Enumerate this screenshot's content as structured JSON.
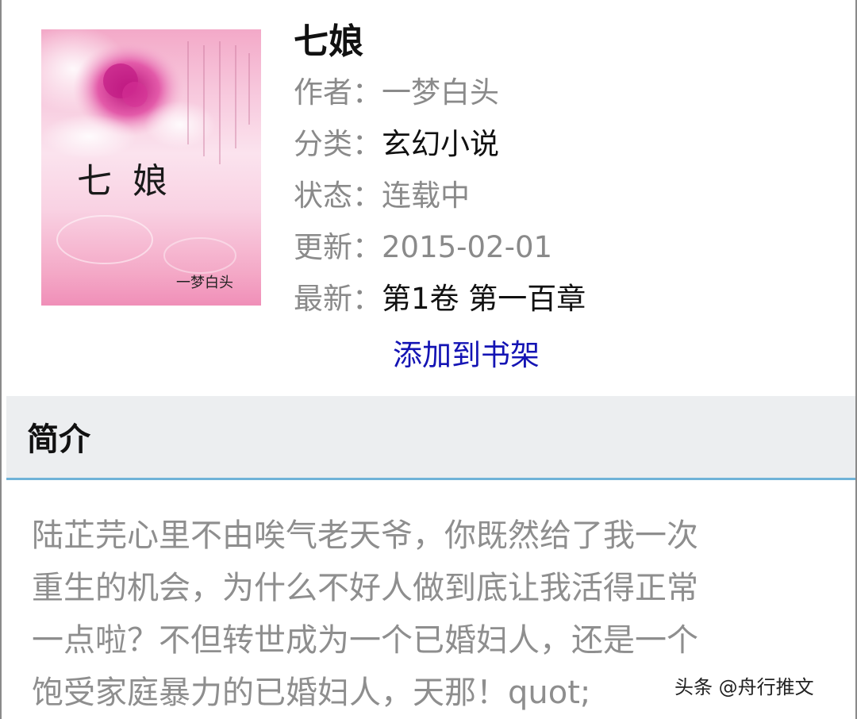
{
  "book": {
    "title": "七娘",
    "cover": {
      "title": "七 娘",
      "author": "一梦白头"
    },
    "author_label": "作者：",
    "author": "一梦白头",
    "category_label": "分类：",
    "category": "玄幻小说",
    "status_label": "状态：",
    "status": "连载中",
    "updated_label": "更新：",
    "updated": "2015-02-01",
    "latest_label": "最新：",
    "latest": "第1卷 第一百章",
    "add_to_shelf": "添加到书架"
  },
  "intro": {
    "heading": "简介",
    "lines": [
      "陆芷芫心里不由唉气老天爷，你既然给了我一次",
      "重生的机会，为什么不好人做到底让我活得正常",
      "一点啦？不但转世成为一个已婚妇人，还是一个",
      "饱受家庭暴力的已婚妇人，天那！quot;"
    ]
  },
  "watermark": "头条 @舟行推文",
  "colors": {
    "link": "#1414b4",
    "muted_text": "#8a8a8a",
    "section_bg": "#eceef0",
    "section_rule": "#6fb3d8"
  }
}
